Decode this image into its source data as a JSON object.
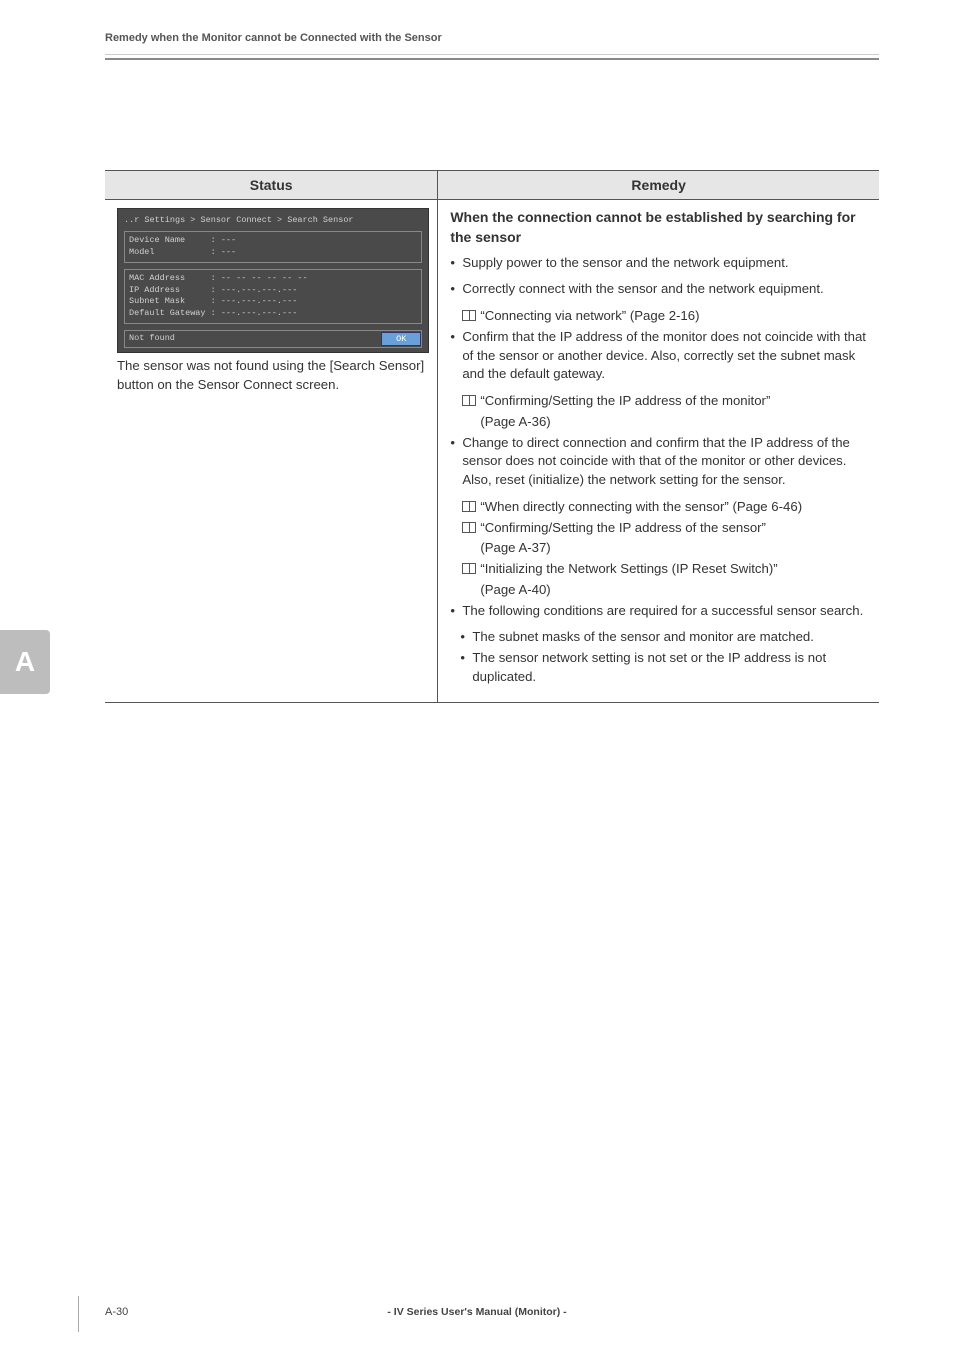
{
  "header": {
    "running_title": "Remedy when the Monitor cannot be Connected with the Sensor"
  },
  "table": {
    "headers": {
      "status": "Status",
      "remedy": "Remedy"
    },
    "status": {
      "screenshot": {
        "title": "..r Settings > Sensor Connect > Search Sensor",
        "device_name_label": "Device Name",
        "device_name_value": ": ---",
        "model_label": "Model",
        "model_value": ": ---",
        "mac_label": "MAC Address",
        "mac_value": ": -- -- -- -- -- --",
        "ip_label": "IP Address",
        "ip_value": ": ---.---.---.---",
        "subnet_label": "Subnet Mask",
        "subnet_value": ": ---.---.---.---",
        "gateway_label": "Default Gateway",
        "gateway_value": ": ---.---.---.---",
        "statusbar_text": "Not found",
        "ok_button": "OK"
      },
      "caption": "The sensor was not found using the [Search Sensor] button on the Sensor Connect screen."
    },
    "remedy": {
      "title": "When the connection cannot be established by searching for the sensor",
      "b1": "Supply power to the sensor and the network equipment.",
      "b2": "Correctly connect with the sensor and the network equipment.",
      "ref2": "“Connecting via network” (Page 2-16)",
      "b3": "Confirm that the IP address of the monitor does not coincide with that of the sensor or another device. Also, correctly set the subnet mask and the default gateway.",
      "ref3a": "“Confirming/Setting the IP address of the monitor”",
      "ref3a_page": "(Page A-36)",
      "b4": "Change to direct connection and confirm that the IP address of the sensor does not coincide with that of the monitor or other devices. Also, reset (initialize) the network setting for the sensor.",
      "ref4a": "“When directly connecting with the sensor” (Page 6-46)",
      "ref4b": "“Confirming/Setting the IP address of the sensor”",
      "ref4b_page": "(Page A-37)",
      "ref4c": "“Initializing the Network Settings (IP Reset Switch)”",
      "ref4c_page": "(Page A-40)",
      "b5": "The following conditions are required for a successful sensor search.",
      "b5s1": "The subnet masks of the sensor and monitor are matched.",
      "b5s2": "The sensor network setting is not set or the IP address is not duplicated."
    }
  },
  "side_tab": "A",
  "footer": {
    "page": "A-30",
    "title": "- IV Series User's Manual (Monitor) -"
  }
}
